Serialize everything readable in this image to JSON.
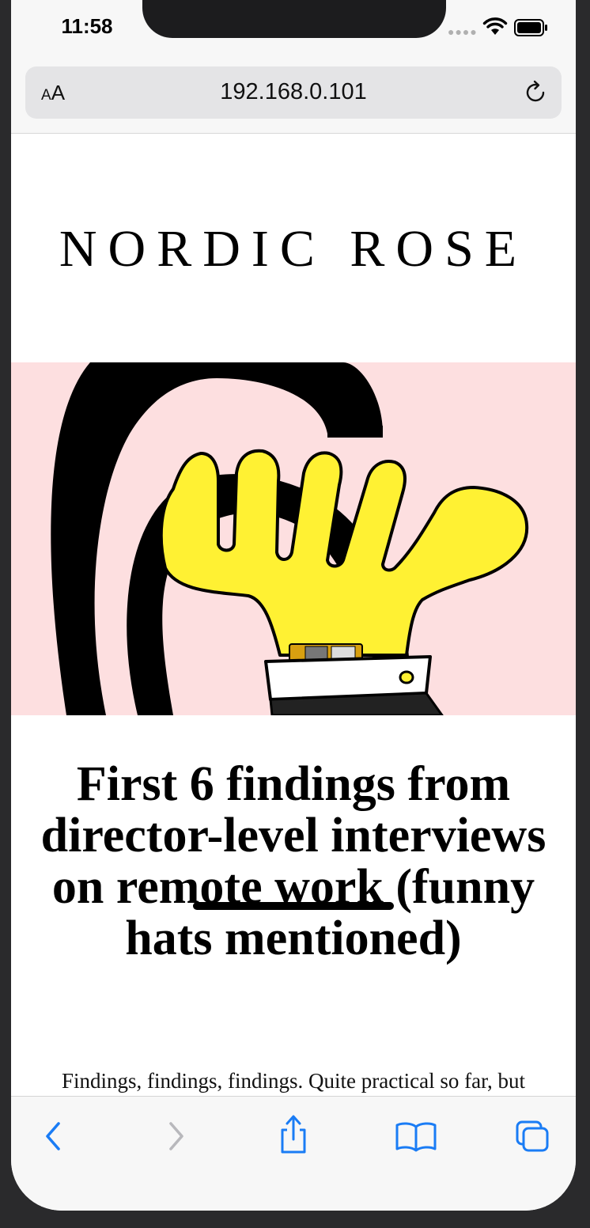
{
  "status_bar": {
    "time": "11:58"
  },
  "browser": {
    "text_size_label_small": "A",
    "text_size_label_large": "A",
    "url": "192.168.0.101"
  },
  "page": {
    "brand": "NORDIC ROSE",
    "headline": "First 6 findings from director-level interviews on remote work (funny hats mentioned)",
    "excerpt": "Findings, findings, findings. Quite practical so far, but"
  },
  "colors": {
    "hero_background": "#fddfe0",
    "ios_blue": "#1a7cf5",
    "disabled_gray": "#b8b8bc"
  }
}
